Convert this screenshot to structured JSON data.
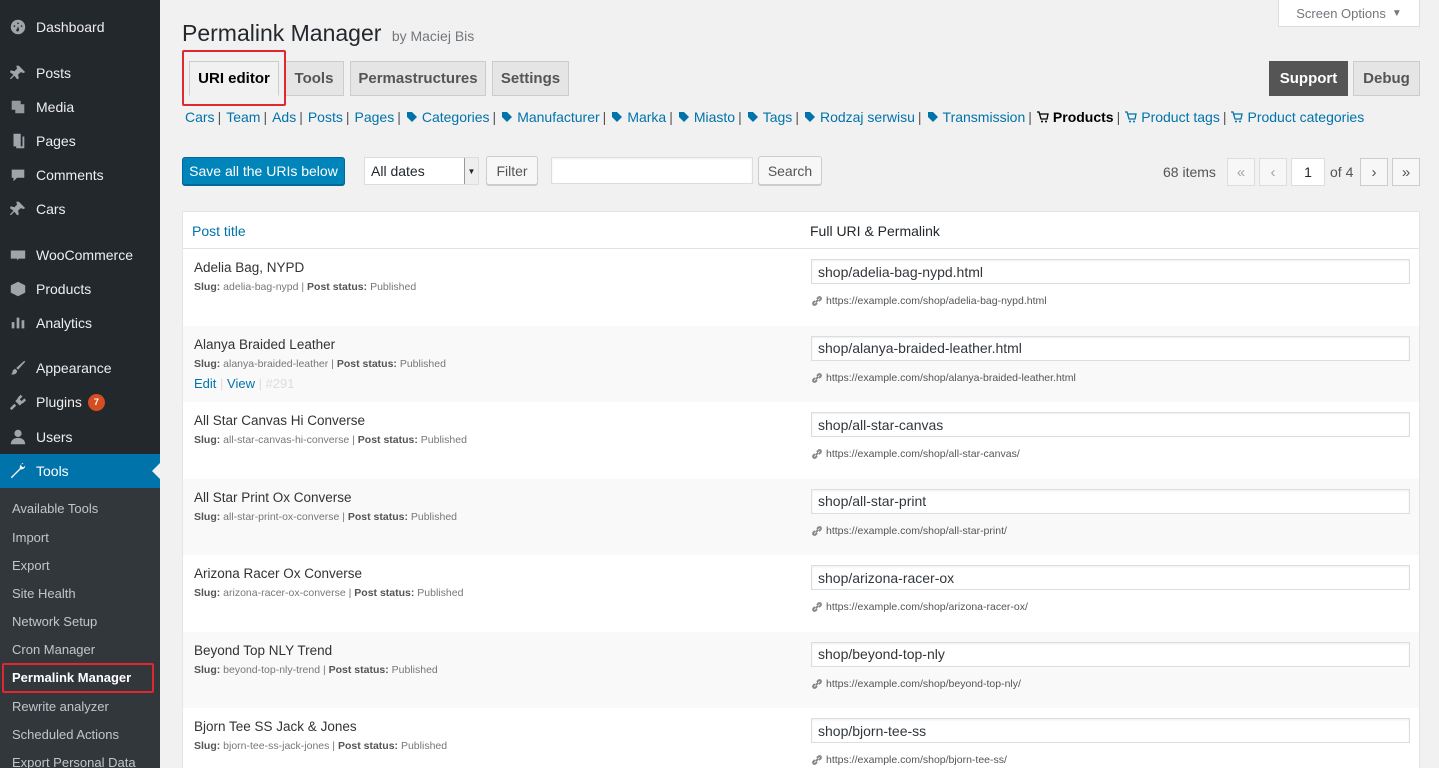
{
  "sidebar": {
    "items": [
      {
        "label": "Dashboard",
        "icon": "dashboard-icon"
      },
      {
        "label": "Posts",
        "icon": "pin-icon"
      },
      {
        "label": "Media",
        "icon": "media-icon"
      },
      {
        "label": "Pages",
        "icon": "pages-icon"
      },
      {
        "label": "Comments",
        "icon": "comment-icon"
      },
      {
        "label": "Cars",
        "icon": "pin-icon"
      },
      {
        "label": "WooCommerce",
        "icon": "woo-icon"
      },
      {
        "label": "Products",
        "icon": "box-icon"
      },
      {
        "label": "Analytics",
        "icon": "bar-chart-icon"
      },
      {
        "label": "Appearance",
        "icon": "brush-icon"
      },
      {
        "label": "Plugins",
        "icon": "plug-icon",
        "badge": "7"
      },
      {
        "label": "Users",
        "icon": "user-icon"
      },
      {
        "label": "Tools",
        "icon": "wrench-icon"
      }
    ],
    "submenu": [
      "Available Tools",
      "Import",
      "Export",
      "Site Health",
      "Network Setup",
      "Cron Manager",
      "Permalink Manager",
      "Rewrite analyzer",
      "Scheduled Actions",
      "Export Personal Data"
    ]
  },
  "header": {
    "screen_options": "Screen Options",
    "title": "Permalink Manager",
    "byline": "by Maciej Bis"
  },
  "tabs": [
    "URI editor",
    "Tools",
    "Permastructures",
    "Settings"
  ],
  "right_tabs": [
    "Support",
    "Debug"
  ],
  "post_types": [
    "Cars",
    "Team",
    "Ads",
    "Posts",
    "Pages",
    "Categories",
    "Manufacturer",
    "Marka",
    "Miasto",
    "Tags",
    "Rodzaj serwisu",
    "Transmission",
    "Products",
    "Product tags",
    "Product categories"
  ],
  "toolbar": {
    "save_label": "Save all the URIs below",
    "dates_value": "All dates",
    "filter_label": "Filter",
    "search_label": "Search",
    "items_count": "68 items",
    "first": "«",
    "prev": "‹",
    "page": "1",
    "of_total": "of 4",
    "next": "›",
    "last": "»"
  },
  "table": {
    "col_title": "Post title",
    "col_uri": "Full URI & Permalink",
    "slug_label": "Slug:",
    "status_label": "Post status:",
    "edit": "Edit",
    "view": "View",
    "rows": [
      {
        "title": "Adelia Bag, NYPD",
        "slug": "adelia-bag-nypd",
        "status": "Published",
        "uri": "shop/adelia-bag-nypd.html",
        "permalink": "https://example.com/shop/adelia-bag-nypd.html"
      },
      {
        "title": "Alanya Braided Leather",
        "slug": "alanya-braided-leather",
        "status": "Published",
        "uri": "shop/alanya-braided-leather.html",
        "permalink": "https://example.com/shop/alanya-braided-leather.html",
        "id": "#291"
      },
      {
        "title": "All Star Canvas Hi Converse",
        "slug": "all-star-canvas-hi-converse",
        "status": "Published",
        "uri": "shop/all-star-canvas",
        "permalink": "https://example.com/shop/all-star-canvas/"
      },
      {
        "title": "All Star Print Ox Converse",
        "slug": "all-star-print-ox-converse",
        "status": "Published",
        "uri": "shop/all-star-print",
        "permalink": "https://example.com/shop/all-star-print/"
      },
      {
        "title": "Arizona Racer Ox Converse",
        "slug": "arizona-racer-ox-converse",
        "status": "Published",
        "uri": "shop/arizona-racer-ox",
        "permalink": "https://example.com/shop/arizona-racer-ox/"
      },
      {
        "title": "Beyond Top NLY Trend",
        "slug": "beyond-top-nly-trend",
        "status": "Published",
        "uri": "shop/beyond-top-nly",
        "permalink": "https://example.com/shop/beyond-top-nly/"
      },
      {
        "title": "Bjorn Tee SS Jack & Jones",
        "slug": "bjorn-tee-ss-jack-jones",
        "status": "Published",
        "uri": "shop/bjorn-tee-ss",
        "permalink": "https://example.com/shop/bjorn-tee-ss/"
      }
    ]
  },
  "colors": {
    "accent": "#0073aa",
    "sidebar": "#23282d",
    "highlight": "#e0282e",
    "badge": "#d54e21"
  }
}
